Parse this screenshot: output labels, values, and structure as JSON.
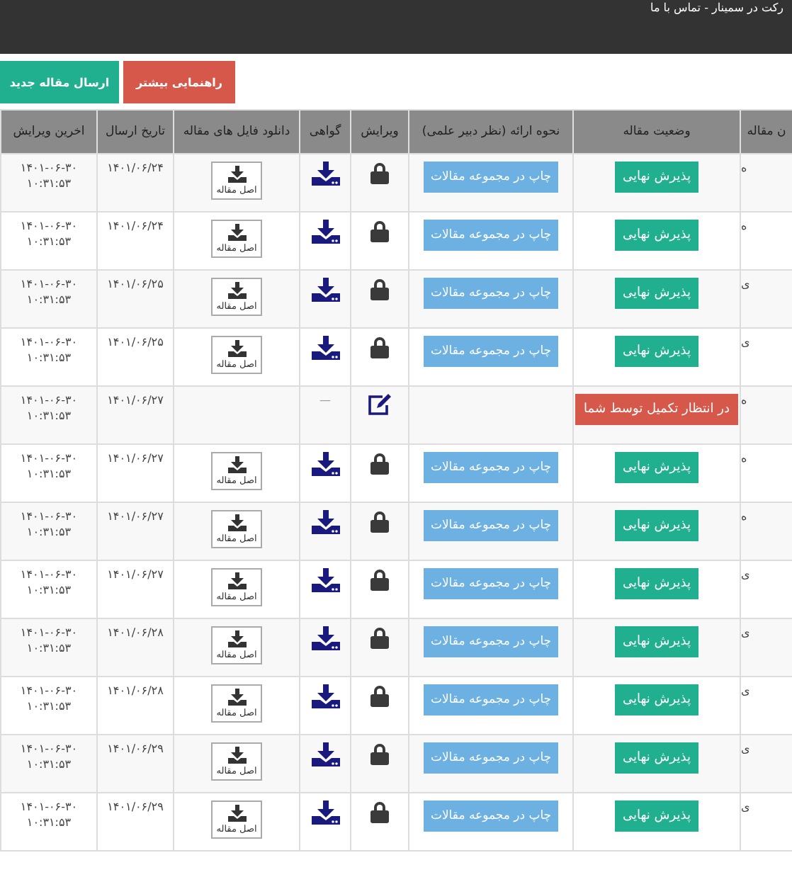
{
  "top_bar": {
    "text": "رکت در سمینار - تماس با ما"
  },
  "actions": [
    {
      "label": "راهنمایی بیشتر",
      "kind": "danger"
    },
    {
      "label": "ارسال مقاله جدید",
      "kind": "primary"
    }
  ],
  "table": {
    "columns": [
      "ن مقاله",
      "وضعیت مقاله",
      "نحوه ارائه (نظر دبیر علمی)",
      "ویرایش",
      "گواهی",
      "دانلود فایل های مقاله",
      "تاریخ ارسال",
      "اخرین ویرایش"
    ],
    "rows": [
      {
        "column_1": "ه",
        "status": {
          "label": "پذیرش نهایی",
          "kind": "accepted"
        },
        "presentation": "چاپ در مجموعه مقالات",
        "locked": true,
        "file_label": "اصل مقاله",
        "sent": "۱۴۰۱/۰۶/۲۴",
        "last_edit_date": "۱۴۰۱-۰۶-۳۰",
        "last_edit_time": "۱۰:۳۱:۵۳"
      },
      {
        "column_1": "ه",
        "status": {
          "label": "پذیرش نهایی",
          "kind": "accepted"
        },
        "presentation": "چاپ در مجموعه مقالات",
        "locked": true,
        "file_label": "اصل مقاله",
        "sent": "۱۴۰۱/۰۶/۲۴",
        "last_edit_date": "۱۴۰۱-۰۶-۳۰",
        "last_edit_time": "۱۰:۳۱:۵۳"
      },
      {
        "column_1": "ی",
        "status": {
          "label": "پذیرش نهایی",
          "kind": "accepted"
        },
        "presentation": "چاپ در مجموعه مقالات",
        "locked": true,
        "file_label": "اصل مقاله",
        "sent": "۱۴۰۱/۰۶/۲۵",
        "last_edit_date": "۱۴۰۱-۰۶-۳۰",
        "last_edit_time": "۱۰:۳۱:۵۳"
      },
      {
        "column_1": "ی",
        "status": {
          "label": "پذیرش نهایی",
          "kind": "accepted"
        },
        "presentation": "چاپ در مجموعه مقالات",
        "locked": true,
        "file_label": "اصل مقاله",
        "sent": "۱۴۰۱/۰۶/۲۵",
        "last_edit_date": "۱۴۰۱-۰۶-۳۰",
        "last_edit_time": "۱۰:۳۱:۵۳"
      },
      {
        "column_1": "ه",
        "status": {
          "label": "در انتظار تکمیل توسط شما",
          "kind": "pending"
        },
        "locked": false,
        "certificate_text": "—",
        "sent": "۱۴۰۱/۰۶/۲۷",
        "last_edit_date": "۱۴۰۱-۰۶-۳۰",
        "last_edit_time": "۱۰:۳۱:۵۳"
      },
      {
        "column_1": "ه",
        "status": {
          "label": "پذیرش نهایی",
          "kind": "accepted"
        },
        "presentation": "چاپ در مجموعه مقالات",
        "locked": true,
        "file_label": "اصل مقاله",
        "sent": "۱۴۰۱/۰۶/۲۷",
        "last_edit_date": "۱۴۰۱-۰۶-۳۰",
        "last_edit_time": "۱۰:۳۱:۵۳"
      },
      {
        "column_1": "ه",
        "status": {
          "label": "پذیرش نهایی",
          "kind": "accepted"
        },
        "presentation": "چاپ در مجموعه مقالات",
        "locked": true,
        "file_label": "اصل مقاله",
        "sent": "۱۴۰۱/۰۶/۲۷",
        "last_edit_date": "۱۴۰۱-۰۶-۳۰",
        "last_edit_time": "۱۰:۳۱:۵۳"
      },
      {
        "column_1": "ی",
        "status": {
          "label": "پذیرش نهایی",
          "kind": "accepted"
        },
        "presentation": "چاپ در مجموعه مقالات",
        "locked": true,
        "file_label": "اصل مقاله",
        "sent": "۱۴۰۱/۰۶/۲۷",
        "last_edit_date": "۱۴۰۱-۰۶-۳۰",
        "last_edit_time": "۱۰:۳۱:۵۳"
      },
      {
        "column_1": "ی",
        "status": {
          "label": "پذیرش نهایی",
          "kind": "accepted"
        },
        "presentation": "چاپ در مجموعه مقالات",
        "locked": true,
        "file_label": "اصل مقاله",
        "sent": "۱۴۰۱/۰۶/۲۸",
        "last_edit_date": "۱۴۰۱-۰۶-۳۰",
        "last_edit_time": "۱۰:۳۱:۵۳"
      },
      {
        "column_1": "ی",
        "status": {
          "label": "پذیرش نهایی",
          "kind": "accepted"
        },
        "presentation": "چاپ در مجموعه مقالات",
        "locked": true,
        "file_label": "اصل مقاله",
        "sent": "۱۴۰۱/۰۶/۲۸",
        "last_edit_date": "۱۴۰۱-۰۶-۳۰",
        "last_edit_time": "۱۰:۳۱:۵۳"
      },
      {
        "column_1": "ی",
        "status": {
          "label": "پذیرش نهایی",
          "kind": "accepted"
        },
        "presentation": "چاپ در مجموعه مقالات",
        "locked": true,
        "file_label": "اصل مقاله",
        "sent": "۱۴۰۱/۰۶/۲۹",
        "last_edit_date": "۱۴۰۱-۰۶-۳۰",
        "last_edit_time": "۱۰:۳۱:۵۳"
      },
      {
        "column_1": "ی",
        "status": {
          "label": "پذیرش نهایی",
          "kind": "accepted"
        },
        "presentation": "چاپ در مجموعه مقالات",
        "locked": true,
        "file_label": "اصل مقاله",
        "sent": "۱۴۰۱/۰۶/۲۹",
        "last_edit_date": "۱۴۰۱-۰۶-۳۰",
        "last_edit_time": "۱۰:۳۱:۵۳"
      }
    ]
  }
}
